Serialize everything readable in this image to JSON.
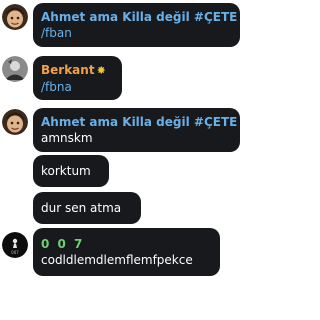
{
  "messages": [
    {
      "sender": "Ahmet ama Killa değil #ÇETE",
      "sender_color": "#6ab0e8",
      "text": "/fban",
      "avatar": "cartoon-face-avatar"
    },
    {
      "sender": "Berkant",
      "sender_color": "#eea24a",
      "badge_icon": "sparkle-star-icon",
      "text": "/fbna",
      "avatar": "photo-avatar"
    },
    {
      "sender": "Ahmet ama Killa değil #ÇETE",
      "sender_color": "#6ab0e8",
      "text": "amnskm",
      "avatar": "cartoon-face-avatar"
    },
    {
      "text": "korktum"
    },
    {
      "text": "dur sen atma"
    },
    {
      "sender": "0 0 7",
      "sender_color": "#6fd06f",
      "text": "codldlemdlemflemfpekce",
      "avatar": "dark-avatar",
      "avatar_caption": "007"
    }
  ]
}
